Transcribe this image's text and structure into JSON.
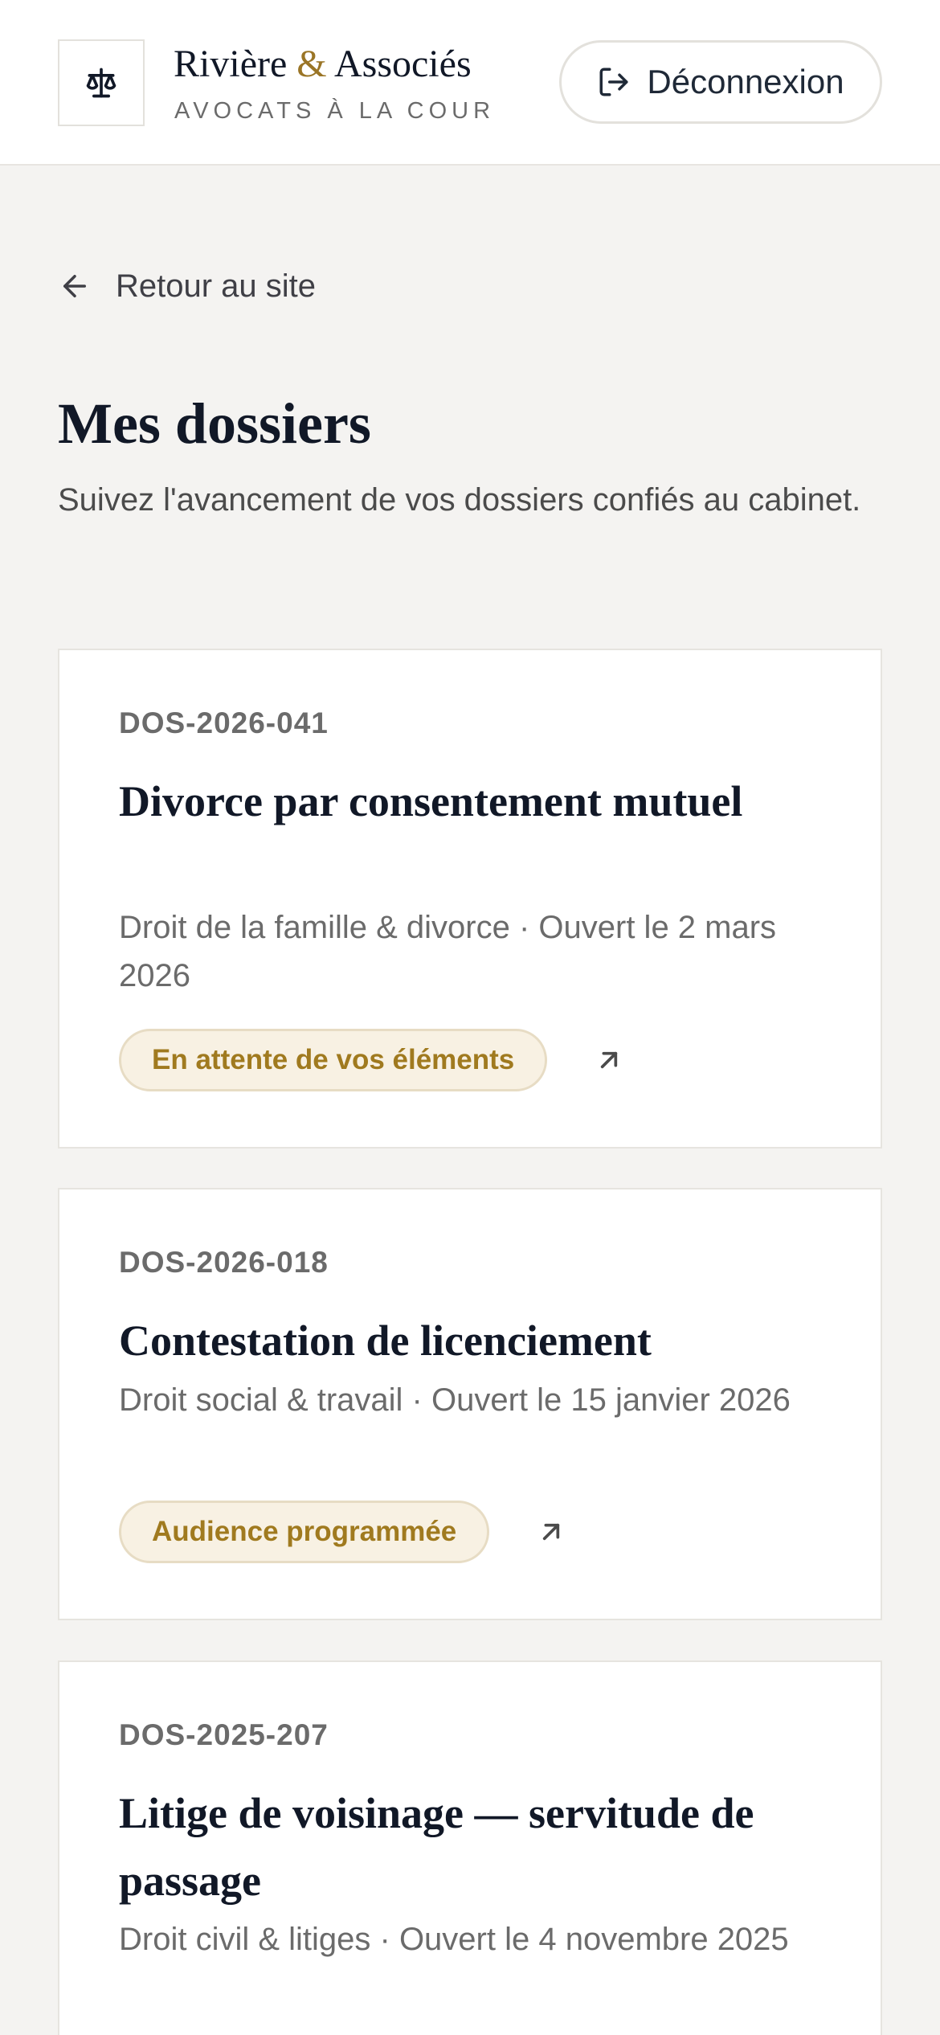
{
  "header": {
    "brand_name_part1": "Rivière ",
    "brand_amp": "&",
    "brand_name_part2": " Associés",
    "brand_tagline": "AVOCATS À LA COUR",
    "logo_icon": "scales-icon",
    "logout_label": "Déconnexion",
    "logout_icon": "logout-icon"
  },
  "nav": {
    "back_label": "Retour au site",
    "back_icon": "arrow-left-icon"
  },
  "page": {
    "title": "Mes dossiers",
    "subtitle": "Suivez l'avancement de vos dossiers confiés au cabinet."
  },
  "colors": {
    "accent": "#9a7526",
    "background": "#f4f3f1",
    "card": "#ffffff",
    "badge_bg": "#f8f1e3",
    "badge_text": "#a07a1f"
  },
  "dossiers": [
    {
      "ref": "DOS-2026-041",
      "title": "Divorce par consentement mutuel",
      "meta": "Droit de la famille & divorce · Ouvert le 2 mars 2026",
      "status": "En attente de vos éléments",
      "action_icon": "arrow-up-right-icon"
    },
    {
      "ref": "DOS-2026-018",
      "title": "Contestation de licenciement",
      "meta": "Droit social & travail · Ouvert le 15 janvier 2026",
      "status": "Audience programmée",
      "action_icon": "arrow-up-right-icon"
    },
    {
      "ref": "DOS-2025-207",
      "title": "Litige de voisinage — servitude de passage",
      "meta": "Droit civil & litiges · Ouvert le 4 novembre 2025"
    }
  ]
}
